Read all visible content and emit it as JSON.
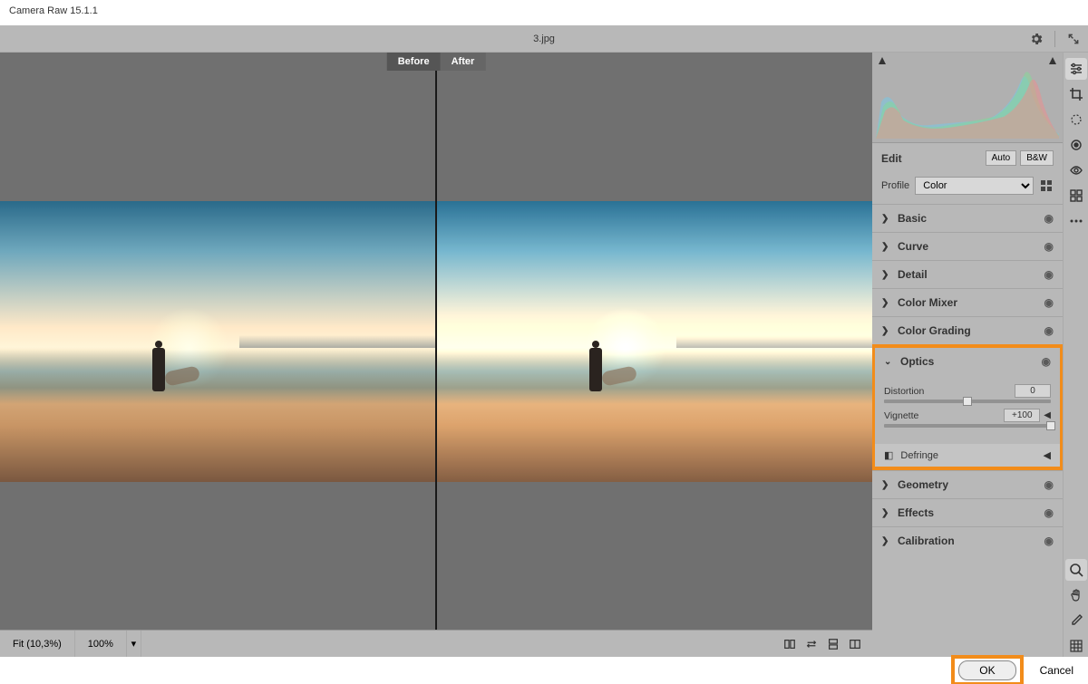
{
  "app_title": "Camera Raw 15.1.1",
  "file_name": "3.jpg",
  "compare": {
    "before": "Before",
    "after": "After"
  },
  "footer": {
    "fit": "Fit (10,3%)",
    "zoom100": "100%"
  },
  "panel": {
    "edit_label": "Edit",
    "auto": "Auto",
    "bw": "B&W",
    "profile_label": "Profile",
    "profile_value": "Color",
    "sections": {
      "basic": "Basic",
      "curve": "Curve",
      "detail": "Detail",
      "color_mixer": "Color Mixer",
      "color_grading": "Color Grading",
      "optics": "Optics",
      "geometry": "Geometry",
      "effects": "Effects",
      "calibration": "Calibration"
    },
    "optics": {
      "distortion_label": "Distortion",
      "distortion_value": "0",
      "vignette_label": "Vignette",
      "vignette_value": "+100"
    },
    "defringe": "Defringe"
  },
  "actions": {
    "ok": "OK",
    "cancel": "Cancel"
  }
}
